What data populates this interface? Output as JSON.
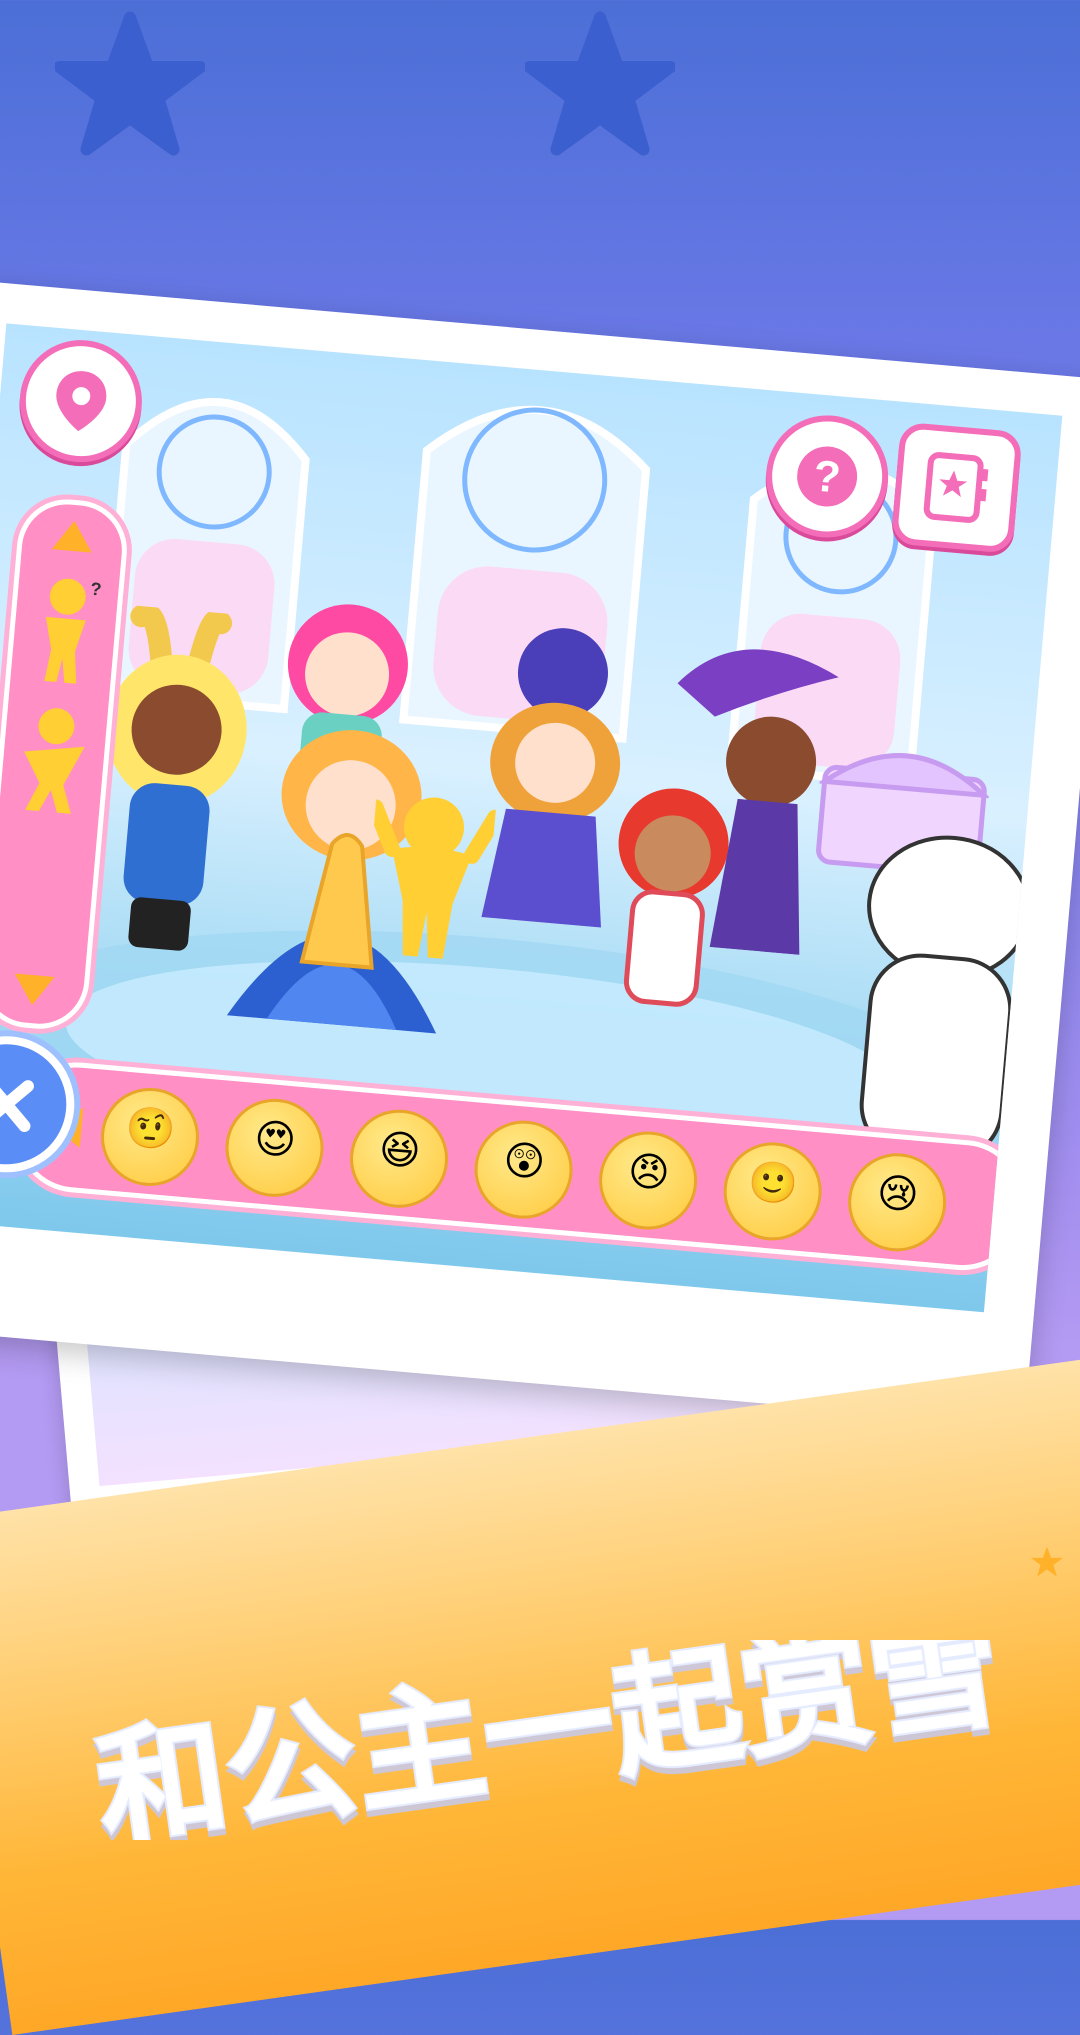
{
  "title": "和公主一起赏雪",
  "colors": {
    "accent_pink": "#f46db8",
    "bar_pink": "#ff8fc4",
    "close_blue": "#5a8df5",
    "banner_orange": "#ffb637"
  },
  "toolbar": {
    "location_icon": "map-pin-icon",
    "help_icon": "question-mark-icon",
    "album_icon": "sticker-album-icon",
    "close_icon": "close-x-icon"
  },
  "pose_bar": {
    "items": [
      "pose-thinking",
      "pose-dance"
    ]
  },
  "emoji_bar": {
    "items": [
      {
        "name": "confused-emoji",
        "glyph": "🤨"
      },
      {
        "name": "heart-eyes-emoji",
        "glyph": "😍"
      },
      {
        "name": "laughing-emoji",
        "glyph": "😆"
      },
      {
        "name": "shocked-emoji",
        "glyph": "😲"
      },
      {
        "name": "angry-emoji",
        "glyph": "😠"
      },
      {
        "name": "smile-emoji",
        "glyph": "🙂"
      },
      {
        "name": "crying-emoji",
        "glyph": "😢"
      }
    ]
  }
}
